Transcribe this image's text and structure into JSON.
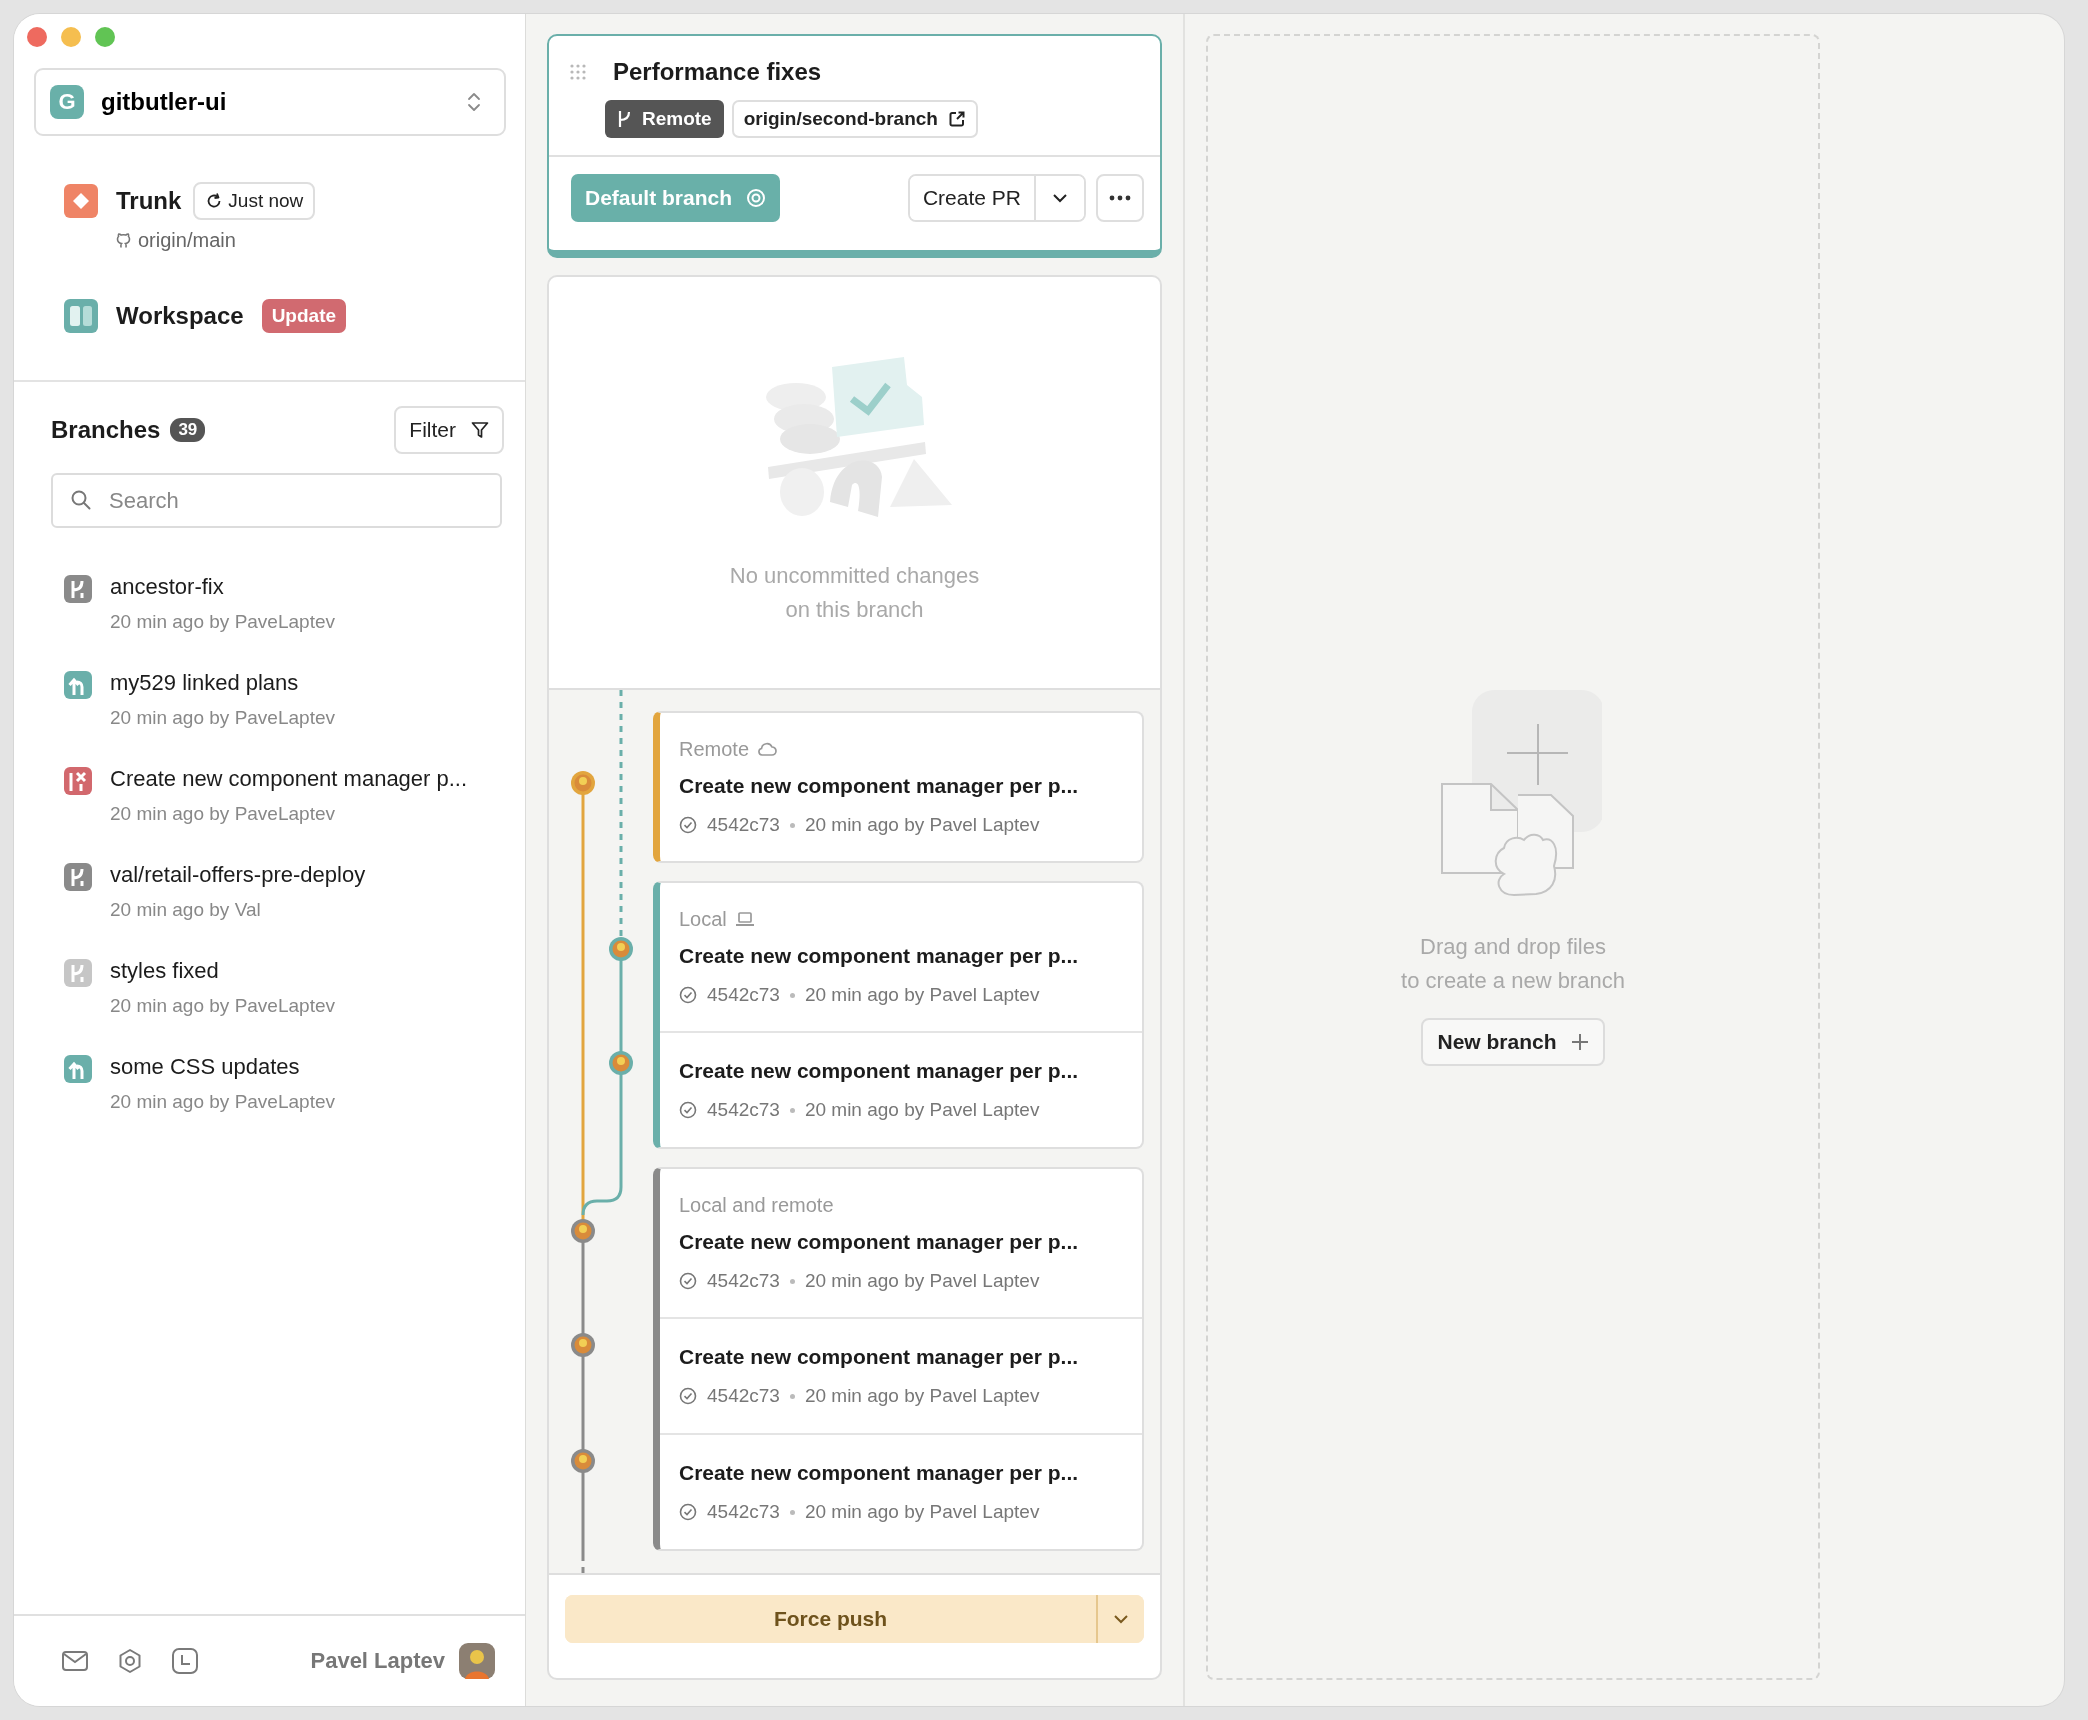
{
  "sidebar": {
    "project": {
      "initial": "G",
      "name": "gitbutler-ui"
    },
    "trunk": {
      "label": "Trunk",
      "sync": "Just now",
      "remote": "origin/main"
    },
    "workspace": {
      "label": "Workspace",
      "badge": "Update"
    },
    "branches": {
      "title": "Branches",
      "count": "39",
      "filter": "Filter",
      "search_placeholder": "Search",
      "items": [
        {
          "name": "ancestor-fix",
          "meta": "20 min ago by PaveLaptev",
          "kind": "unapplied"
        },
        {
          "name": "my529 linked plans",
          "meta": "20 min ago by PaveLaptev",
          "kind": "applied"
        },
        {
          "name": "Create new component manager p...",
          "meta": "20 min ago by PaveLaptev",
          "kind": "conflicted"
        },
        {
          "name": "val/retail-offers-pre-deploy",
          "meta": "20 min ago by Val",
          "kind": "unapplied"
        },
        {
          "name": "styles fixed",
          "meta": "20 min ago by PaveLaptev",
          "kind": "stale"
        },
        {
          "name": "some CSS updates",
          "meta": "20 min ago by PaveLaptev",
          "kind": "applied"
        }
      ]
    },
    "footer": {
      "user": "Pavel Laptev"
    }
  },
  "branch_lane": {
    "title": "Performance fixes",
    "remote_tag": "Remote",
    "remote_branch": "origin/second-branch",
    "default_branch": "Default branch",
    "create_pr": "Create PR",
    "empty_state": [
      "No uncommitted changes",
      "on this branch"
    ],
    "groups": [
      {
        "kind": "remote",
        "label": "Remote",
        "commits": [
          {
            "title": "Create new component manager per p...",
            "hash": "4542c73",
            "meta": "20 min ago by Pavel Laptev"
          }
        ]
      },
      {
        "kind": "local",
        "label": "Local",
        "commits": [
          {
            "title": "Create new component manager per p...",
            "hash": "4542c73",
            "meta": "20 min ago by Pavel Laptev"
          },
          {
            "title": "Create new component manager per p...",
            "hash": "4542c73",
            "meta": "20 min ago by Pavel Laptev"
          }
        ]
      },
      {
        "kind": "local-and-remote",
        "label": "Local and remote",
        "commits": [
          {
            "title": "Create new component manager per p...",
            "hash": "4542c73",
            "meta": "20 min ago by Pavel Laptev"
          },
          {
            "title": "Create new component manager per p...",
            "hash": "4542c73",
            "meta": "20 min ago by Pavel Laptev"
          },
          {
            "title": "Create new component manager per p...",
            "hash": "4542c73",
            "meta": "20 min ago by Pavel Laptev"
          }
        ]
      }
    ],
    "push": "Force push"
  },
  "drop_zone": {
    "lines": [
      "Drag and drop files",
      "to create a new branch"
    ],
    "button": "New branch"
  }
}
